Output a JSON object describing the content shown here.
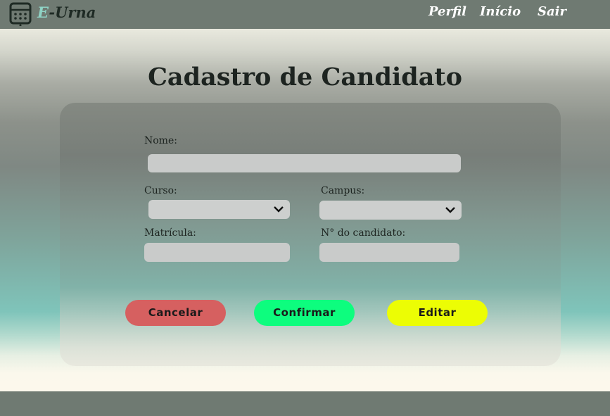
{
  "navbar": {
    "logo_prefix": "E",
    "logo_suffix": "-Urna",
    "links": [
      "Perfil",
      "Início",
      "Sair"
    ]
  },
  "form": {
    "title": "Cadastro de Candidato",
    "nome_label": "Nome:",
    "nome_value": "",
    "curso_label": "Curso:",
    "curso_value": "",
    "campus_label": "Campus:",
    "campus_value": "",
    "matricula_label": "Matrícula:",
    "matricula_value": "",
    "numero_label": "N° do candidato:",
    "numero_value": ""
  },
  "buttons": {
    "cancel": "Cancelar",
    "confirm": "Confirmar",
    "edit": "Editar"
  },
  "colors": {
    "cancel": "#d66060",
    "confirm": "#0dfd7e",
    "edit": "#ecfd04",
    "navbar": "#6f7a72"
  },
  "icons": {
    "logo": "ballot-box-icon",
    "dropdown": "chevron-down-icon"
  }
}
